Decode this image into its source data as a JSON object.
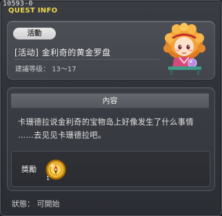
{
  "window": {
    "quest_id": "10593-0",
    "label": "QUEST INFO"
  },
  "quest": {
    "category_badge": "活動",
    "title": "[活动] 金利奇的黄金罗盘",
    "recommended_level": "建議等级： 13～17"
  },
  "content": {
    "header": "內容",
    "lines": [
      "卡珊德拉说金利奇的宝物岛上好像发生了什么事情",
      "……去见见卡珊德拉吧。"
    ]
  },
  "reward": {
    "label": "獎勵",
    "item_icon": "gold-compass-icon"
  },
  "status": {
    "text": "狀態： 可開始"
  },
  "colors": {
    "quest_info_label": "#f1d94a",
    "panel": "#45484f",
    "badge_bg": "#e0e0e1"
  }
}
